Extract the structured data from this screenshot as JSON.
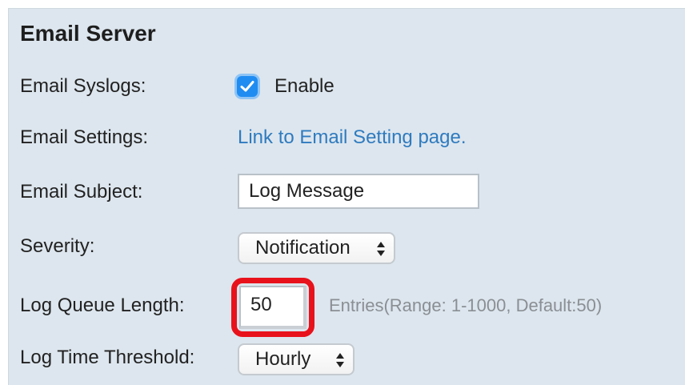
{
  "section": {
    "title": "Email Server"
  },
  "rows": {
    "syslogs": {
      "label": "Email Syslogs:",
      "checkbox_checked": true,
      "checkbox_label": "Enable"
    },
    "settings": {
      "label": "Email Settings:",
      "link_text": "Link to Email Setting page."
    },
    "subject": {
      "label": "Email Subject:",
      "value": "Log Message"
    },
    "severity": {
      "label": "Severity:",
      "selected": "Notification"
    },
    "queue_length": {
      "label": "Log Queue Length:",
      "value": "50",
      "hint": "Entries(Range: 1-1000, Default:50)"
    },
    "time_threshold": {
      "label": "Log Time Threshold:",
      "selected": "Hourly"
    }
  },
  "colors": {
    "panel_background": "#dde6ee",
    "link": "#2f7bbf",
    "checkbox_accent": "#1f8cf2",
    "highlight_outline": "#e8121c",
    "hint_text": "#8a8f94"
  },
  "icons": {
    "checkbox": "checkmark-icon",
    "select_arrows": "up-down-arrows-icon"
  }
}
